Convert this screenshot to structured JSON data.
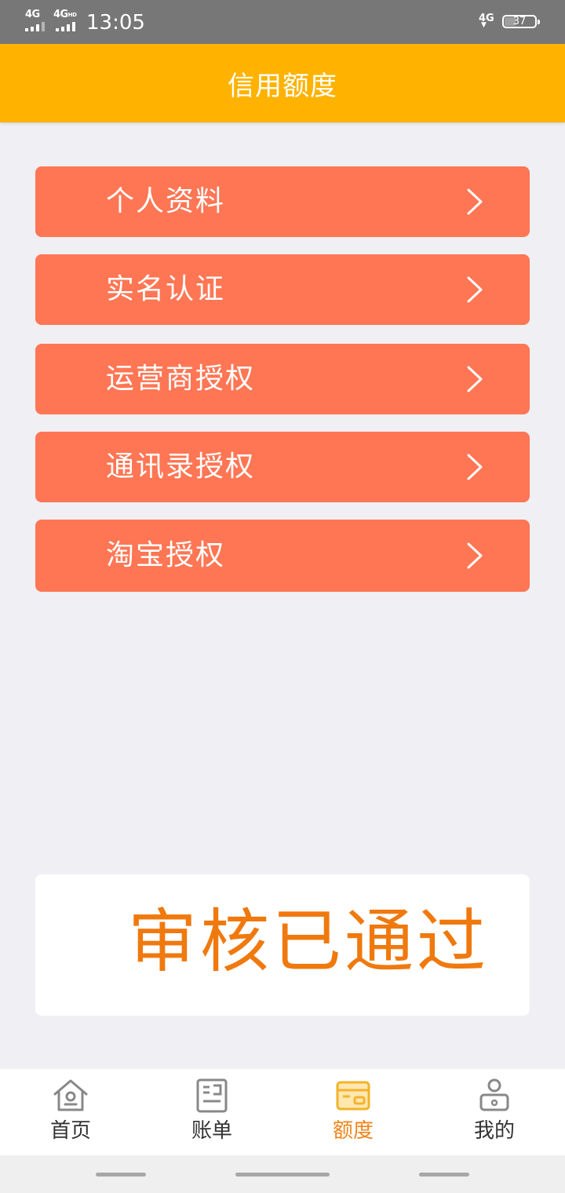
{
  "status_bar": {
    "sim1": "4G",
    "sim2": "4G",
    "sim2_badge": "HD",
    "time": "13:05",
    "net_right": "4G",
    "battery": "37",
    "battery_level": 0.37
  },
  "header": {
    "title": "信用额度"
  },
  "menu": [
    {
      "label": "个人资料"
    },
    {
      "label": "实名认证"
    },
    {
      "label": "运营商授权"
    },
    {
      "label": "通讯录授权"
    },
    {
      "label": "淘宝授权"
    }
  ],
  "status_card": {
    "text": "审核已通过"
  },
  "tabs": [
    {
      "label": "首页",
      "icon": "home-icon"
    },
    {
      "label": "账单",
      "icon": "bill-icon"
    },
    {
      "label": "额度",
      "icon": "credit-card-icon",
      "active": true
    },
    {
      "label": "我的",
      "icon": "profile-icon"
    }
  ],
  "colors": {
    "header": "#ffb300",
    "menu_item": "#ff7654",
    "status_text": "#f0790e",
    "tab_active": "#f08519",
    "tab_inactive": "#888888"
  }
}
